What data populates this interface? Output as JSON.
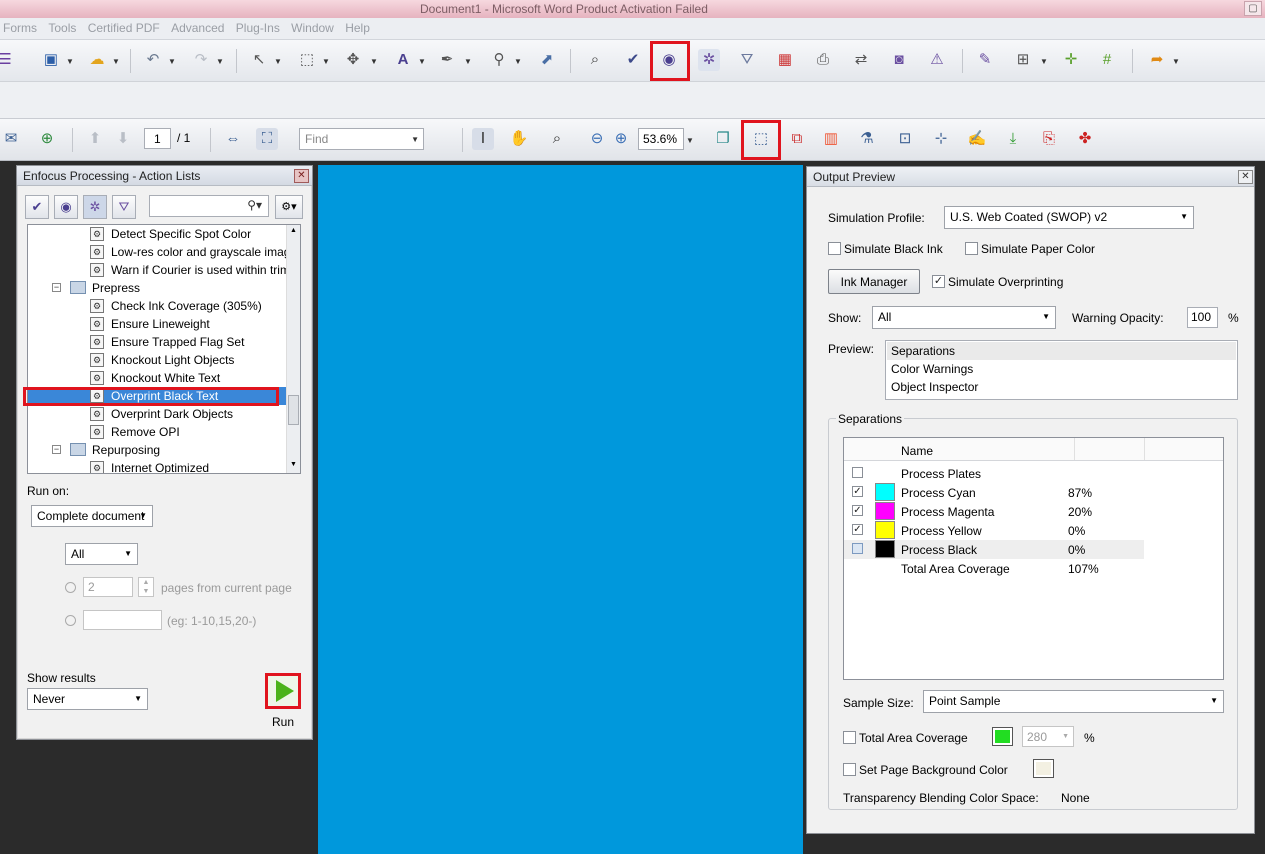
{
  "window": {
    "title": "Document1 - Microsoft Word Product Activation Failed"
  },
  "menu": [
    "Forms",
    "Tools",
    "Certified PDF",
    "Advanced",
    "Plug-Ins",
    "Window",
    "Help"
  ],
  "nav": {
    "page_current": "1",
    "page_total": "/ 1",
    "find_placeholder": "Find",
    "zoom": "53.6%"
  },
  "left_panel": {
    "title": "Enfocus Processing - Action Lists",
    "tree": [
      {
        "label": "Detect Specific Spot Color"
      },
      {
        "label": "Low-res color and grayscale images:"
      },
      {
        "label": "Warn if Courier is used within trim box"
      },
      {
        "label": "Prepress",
        "folder": true
      },
      {
        "label": "Check Ink Coverage (305%)"
      },
      {
        "label": "Ensure Lineweight"
      },
      {
        "label": "Ensure Trapped Flag Set"
      },
      {
        "label": "Knockout Light Objects"
      },
      {
        "label": "Knockout White Text"
      },
      {
        "label": "Overprint Black Text",
        "selected": true
      },
      {
        "label": "Overprint Dark Objects"
      },
      {
        "label": "Remove OPI"
      },
      {
        "label": "Repurposing",
        "folder": true
      },
      {
        "label": "Internet Optimized"
      }
    ],
    "run_on_label": "Run on:",
    "run_on_value": "Complete document",
    "pages_value": "All",
    "pages_count": "2",
    "pages_from_label": "pages from current page",
    "range_hint": "(eg: 1-10,15,20-)",
    "show_results_label": "Show results",
    "show_results_value": "Never",
    "run_label": "Run"
  },
  "output_preview": {
    "title": "Output Preview",
    "simulation_profile_label": "Simulation Profile:",
    "simulation_profile_value": "U.S. Web Coated (SWOP) v2",
    "simulate_black_ink": "Simulate Black Ink",
    "simulate_paper_color": "Simulate Paper Color",
    "ink_manager": "Ink Manager",
    "simulate_overprinting": "Simulate Overprinting",
    "show_label": "Show:",
    "show_value": "All",
    "warning_opacity_label": "Warning Opacity:",
    "warning_opacity_value": "100",
    "percent": "%",
    "preview_label": "Preview:",
    "preview_options": [
      "Separations",
      "Color Warnings",
      "Object Inspector"
    ],
    "separations_group": "Separations",
    "table_header_name": "Name",
    "separations": [
      {
        "name": "Process Plates",
        "checked": false,
        "color": "",
        "value": ""
      },
      {
        "name": "Process Cyan",
        "checked": true,
        "color": "#00ffff",
        "value": "87%"
      },
      {
        "name": "Process Magenta",
        "checked": true,
        "color": "#ff00ff",
        "value": "20%"
      },
      {
        "name": "Process Yellow",
        "checked": true,
        "color": "#ffff00",
        "value": "0%"
      },
      {
        "name": "Process Black",
        "checked": false,
        "color": "#000000",
        "value": "0%"
      },
      {
        "name": "Total Area Coverage",
        "checked": null,
        "color": "",
        "value": "107%"
      }
    ],
    "sample_size_label": "Sample Size:",
    "sample_size_value": "Point Sample",
    "total_area_coverage_label": "Total Area Coverage",
    "tac_value": "280",
    "set_page_bg_label": "Set Page Background Color",
    "blend_space_label": "Transparency Blending Color Space:",
    "blend_space_value": "None"
  },
  "colors": {
    "page": "#0098dc",
    "highlight": "#e0141e",
    "selection": "#3a87d8",
    "run": "#4bb31a",
    "tac_swatch": "#22dd22"
  }
}
